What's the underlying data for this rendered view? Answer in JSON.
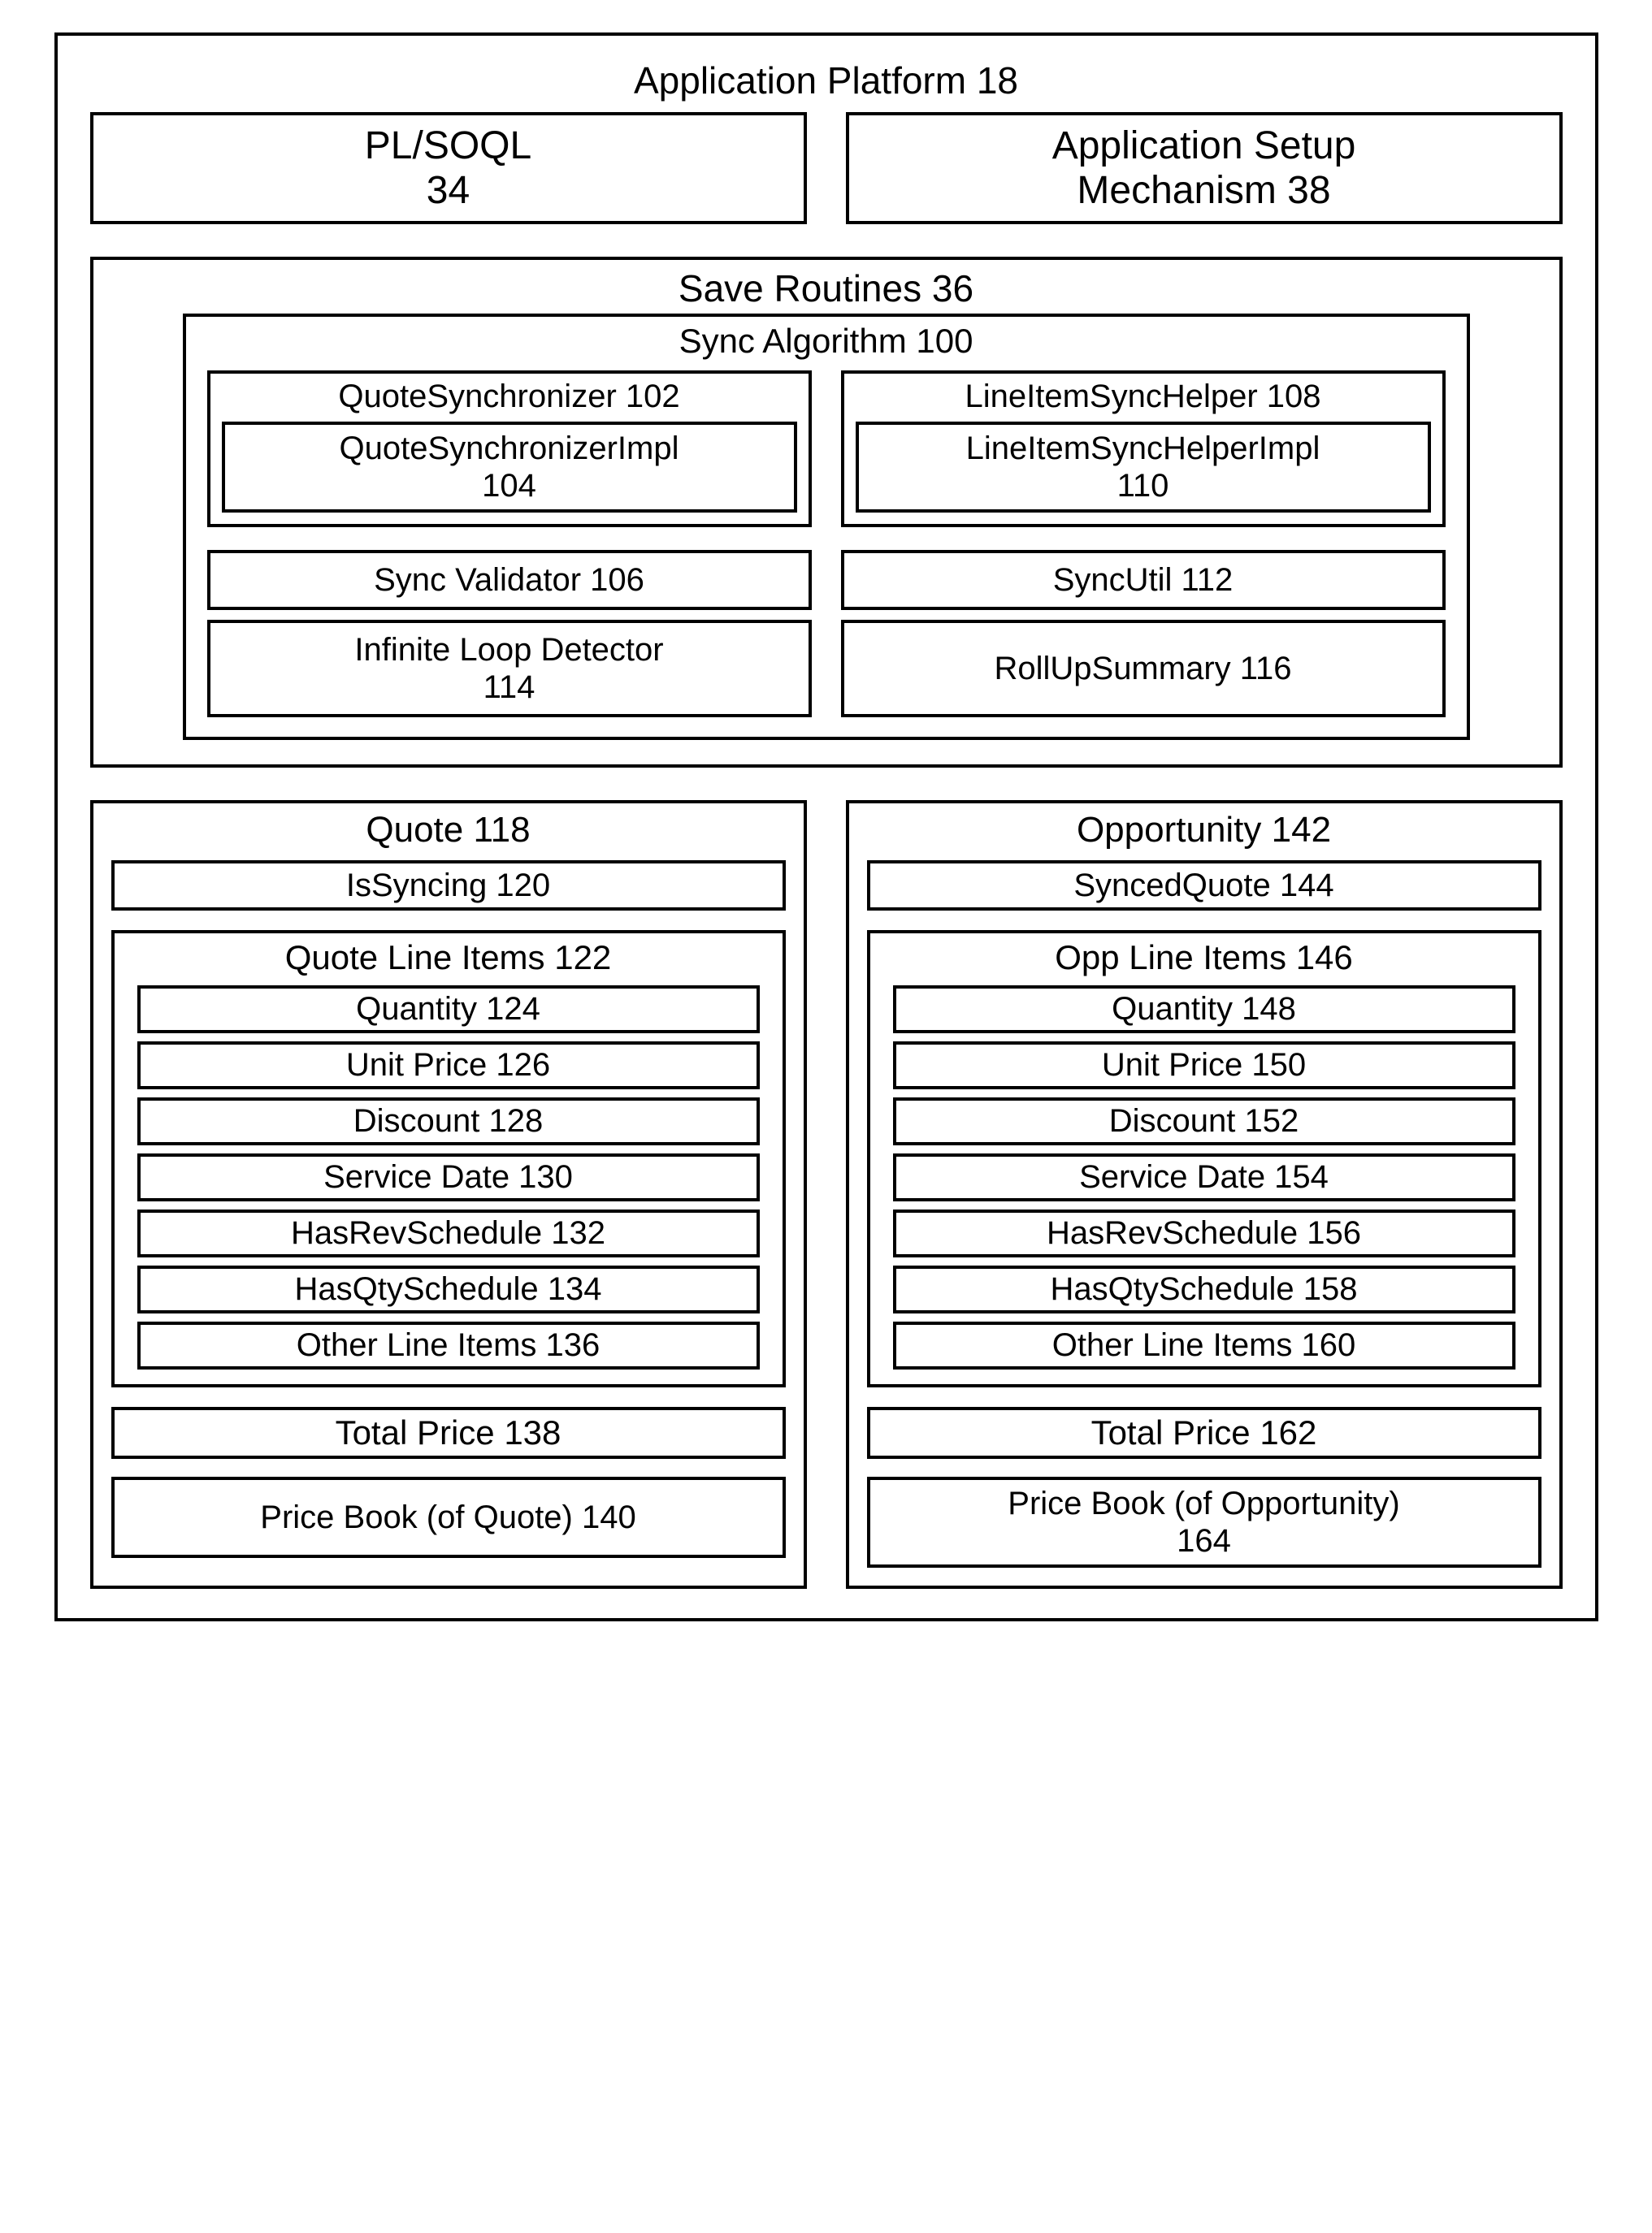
{
  "platform": {
    "title": "Application Platform 18"
  },
  "plsoql": {
    "line1": "PL/SOQL",
    "line2": "34"
  },
  "appsetup": {
    "line1": "Application Setup",
    "line2": "Mechanism 38"
  },
  "save": {
    "title": "Save Routines 36",
    "sync": {
      "title": "Sync Algorithm 100",
      "qs": {
        "title": "QuoteSynchronizer 102",
        "impl1": "QuoteSynchronizerImpl",
        "impl2": "104"
      },
      "lish": {
        "title": "LineItemSyncHelper 108",
        "impl1": "LineItemSyncHelperImpl",
        "impl2": "110"
      },
      "validator": "Sync Validator 106",
      "syncutil": "SyncUtil 112",
      "loop1": "Infinite Loop Detector",
      "loop2": "114",
      "rollup": "RollUpSummary 116"
    }
  },
  "quote": {
    "title": "Quote 118",
    "issync": "IsSyncing 120",
    "li_title": "Quote Line Items 122",
    "li": {
      "qty": "Quantity 124",
      "unit": "Unit Price 126",
      "disc": "Discount 128",
      "svc": "Service Date 130",
      "rev": "HasRevSchedule 132",
      "qtys": "HasQtySchedule 134",
      "other": "Other Line Items 136"
    },
    "total": "Total Price 138",
    "pricebook": "Price Book (of Quote) 140"
  },
  "opp": {
    "title": "Opportunity 142",
    "synced": "SyncedQuote 144",
    "li_title": "Opp Line Items 146",
    "li": {
      "qty": "Quantity 148",
      "unit": "Unit Price 150",
      "disc": "Discount 152",
      "svc": "Service Date 154",
      "rev": "HasRevSchedule 156",
      "qtys": "HasQtySchedule 158",
      "other": "Other Line Items 160"
    },
    "total": "Total Price 162",
    "pricebook1": "Price Book (of Opportunity)",
    "pricebook2": "164"
  }
}
